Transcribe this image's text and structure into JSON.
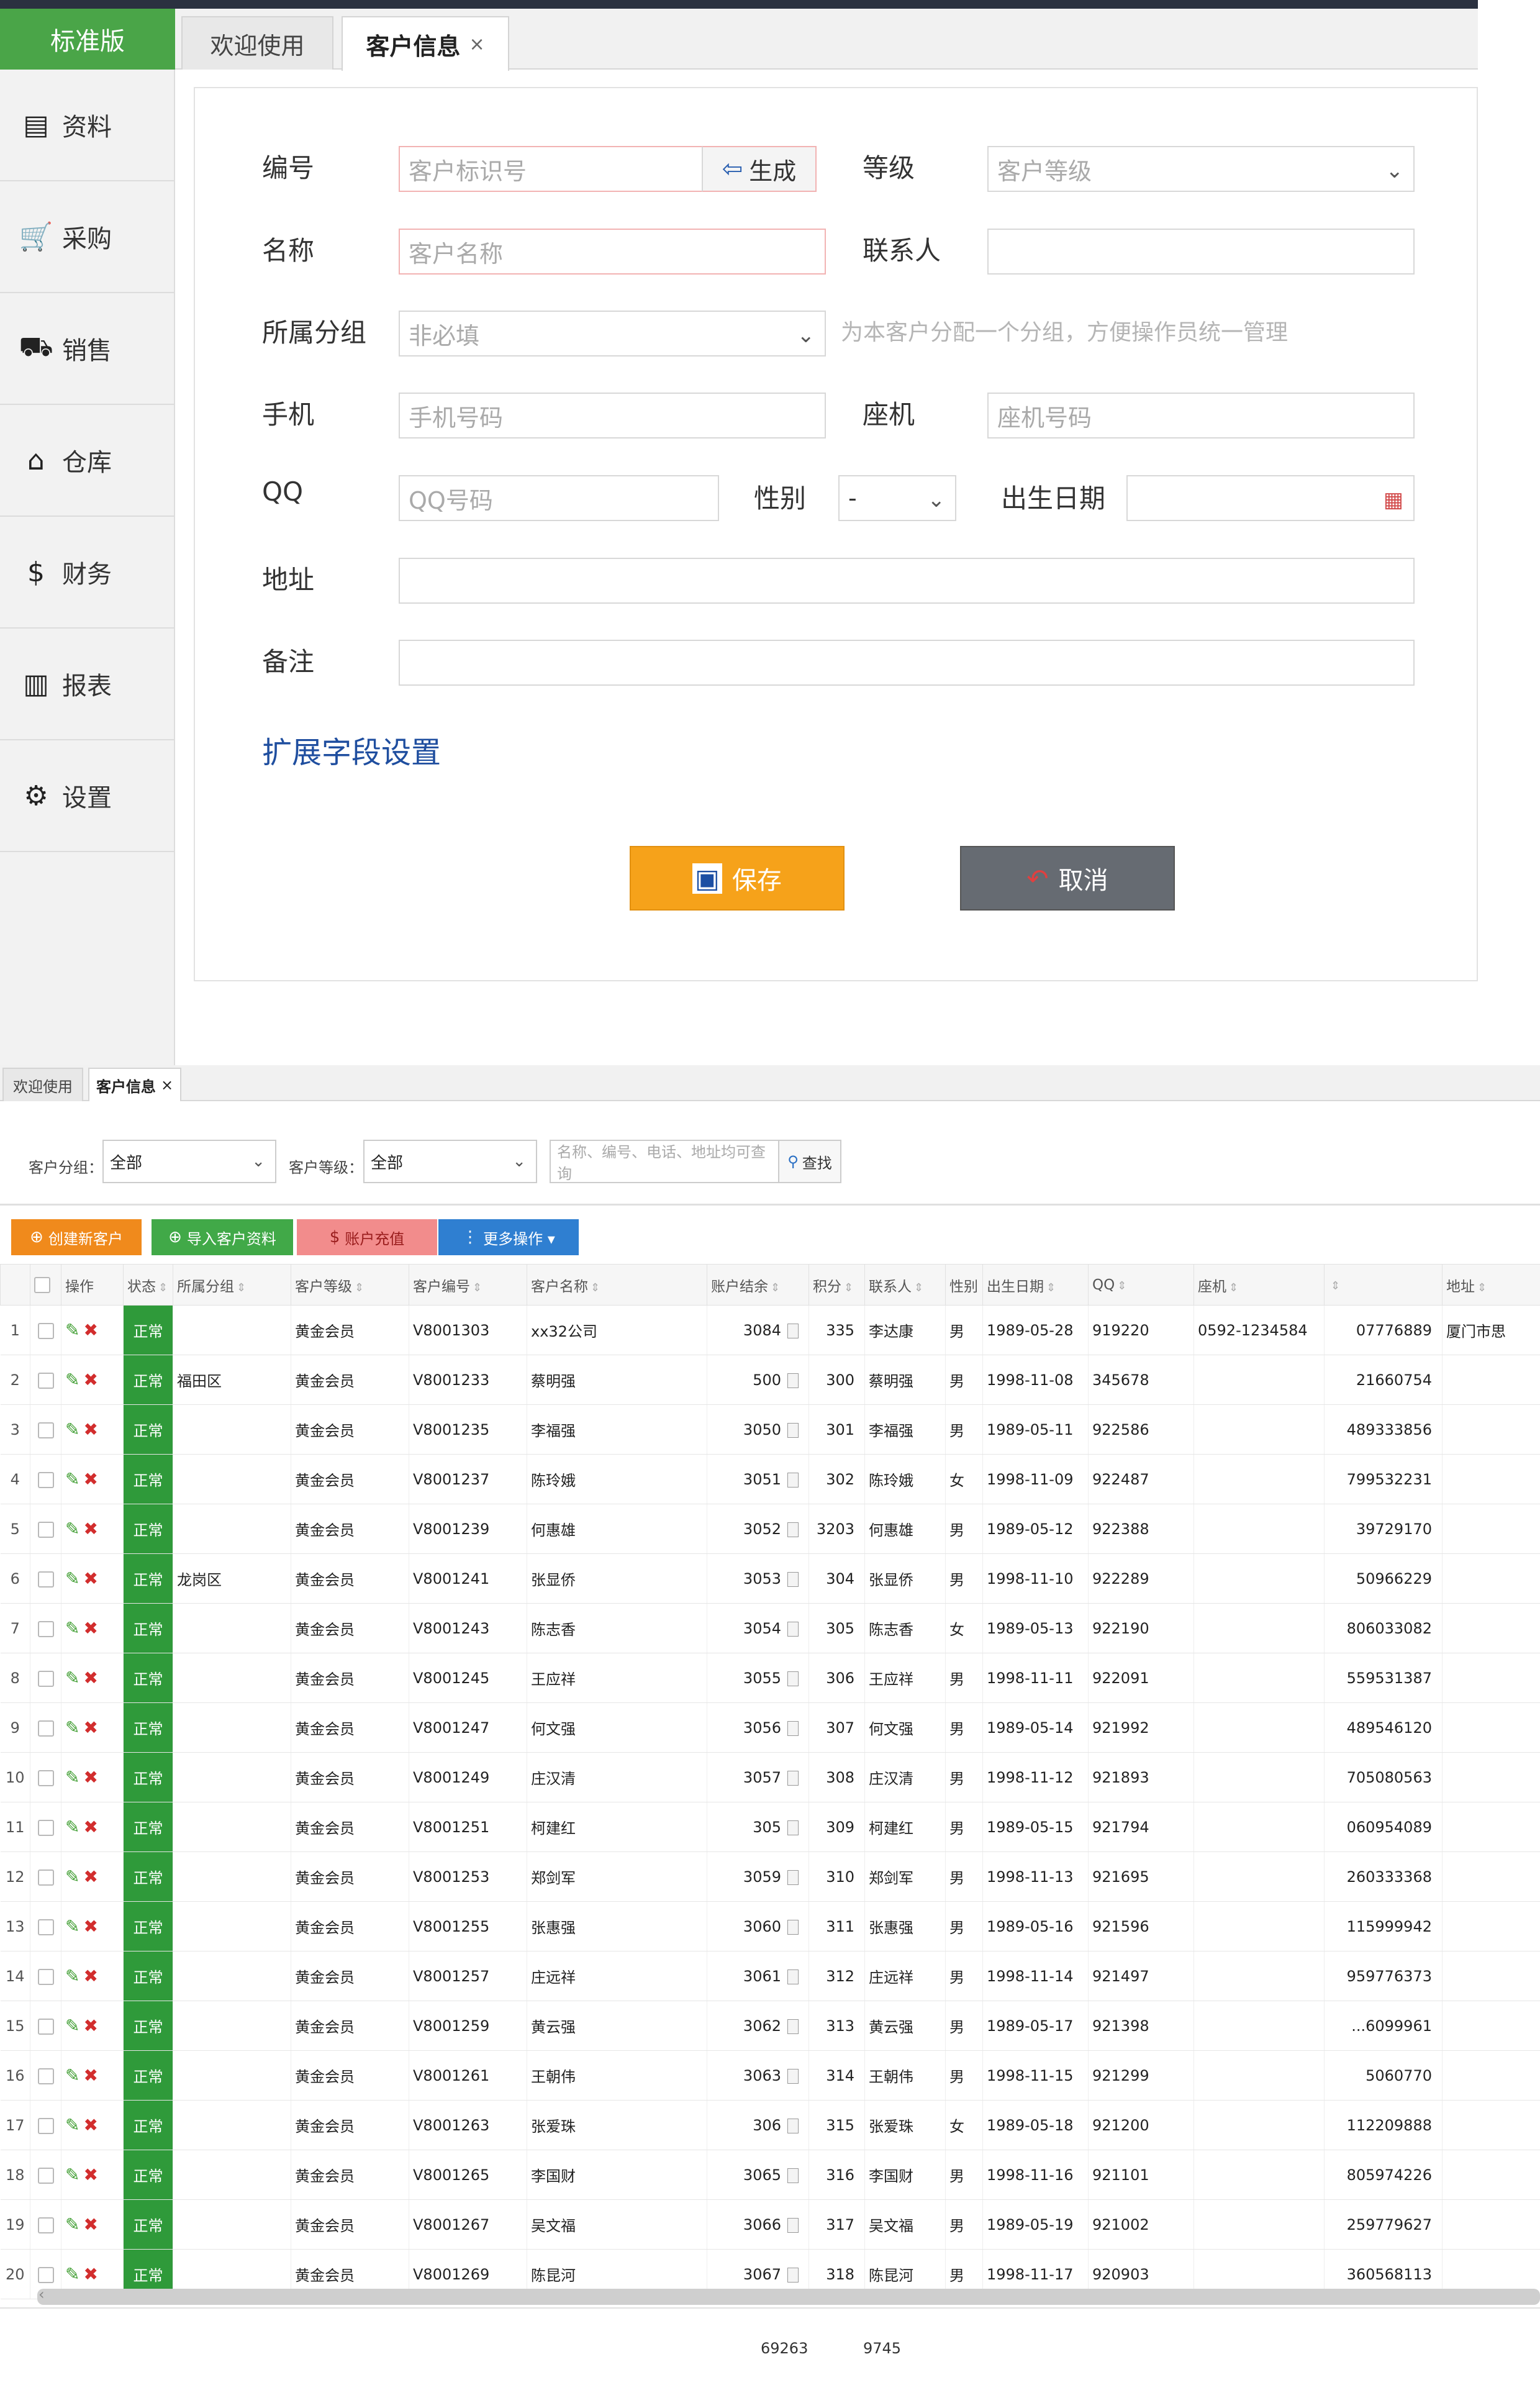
{
  "top": {
    "edition": "标准版",
    "sidebar": [
      {
        "icon": "database-icon",
        "label": "资料"
      },
      {
        "icon": "cart-icon",
        "label": "采购"
      },
      {
        "icon": "truck-icon",
        "label": "销售"
      },
      {
        "icon": "warehouse-icon",
        "label": "仓库"
      },
      {
        "icon": "money-icon",
        "label": "财务"
      },
      {
        "icon": "report-icon",
        "label": "报表"
      },
      {
        "icon": "gear-icon",
        "label": "设置"
      }
    ],
    "tabs": {
      "welcome": "欢迎使用",
      "customer": "客户信息",
      "close": "×"
    },
    "form": {
      "code_label": "编号",
      "code_placeholder": "客户标识号",
      "generate_label": "生成",
      "level_label": "等级",
      "level_placeholder": "客户等级",
      "name_label": "名称",
      "name_placeholder": "客户名称",
      "contact_label": "联系人",
      "contact_value": "",
      "group_label": "所属分组",
      "group_placeholder": "非必填",
      "group_hint": "为本客户分配一个分组，方便操作员统一管理",
      "mobile_label": "手机",
      "mobile_placeholder": "手机号码",
      "phone_label": "座机",
      "phone_placeholder": "座机号码",
      "qq_label": "QQ",
      "qq_placeholder": "QQ号码",
      "gender_label": "性别",
      "gender_value": "-",
      "birthday_label": "出生日期",
      "birthday_value": "",
      "address_label": "地址",
      "address_value": "",
      "remark_label": "备注",
      "remark_value": "",
      "extend_link": "扩展字段设置",
      "save_label": "保存",
      "cancel_label": "取消"
    }
  },
  "bottom": {
    "tabs": {
      "welcome": "欢迎使用",
      "customer": "客户信息",
      "close": "×"
    },
    "filters": {
      "group_label": "客户分组：",
      "group_value": "全部",
      "level_label": "客户等级：",
      "level_value": "全部",
      "search_placeholder": "名称、编号、电话、地址均可查询",
      "search_label": "查找"
    },
    "actions": {
      "create": "创建新客户",
      "import": "导入客户资料",
      "recharge": "账户充值",
      "more": "更多操作 ▾"
    },
    "columns": [
      "",
      "操作",
      "状态",
      "所属分组",
      "客户等级",
      "客户编号",
      "客户名称",
      "账户结余",
      "积分",
      "联系人",
      "性别",
      "出生日期",
      "QQ",
      "座机",
      "",
      "地址"
    ],
    "rows": [
      {
        "n": "1",
        "status": "正常",
        "group": "",
        "level": "黄金会员",
        "code": "V8001303",
        "name": "xx32公司",
        "balance": "3084",
        "points": "335",
        "contact": "李达康",
        "sex": "男",
        "birth": "1989-05-28",
        "qq": "919220",
        "phone": "0592-1234584",
        "mobile": "07776889",
        "addr": "厦门市思"
      },
      {
        "n": "2",
        "status": "正常",
        "group": "福田区",
        "level": "黄金会员",
        "code": "V8001233",
        "name": "蔡明强",
        "balance": "500",
        "points": "300",
        "contact": "蔡明强",
        "sex": "男",
        "birth": "1998-11-08",
        "qq": "345678",
        "phone": "",
        "mobile": "21660754",
        "addr": ""
      },
      {
        "n": "3",
        "status": "正常",
        "group": "",
        "level": "黄金会员",
        "code": "V8001235",
        "name": "李福强",
        "balance": "3050",
        "points": "301",
        "contact": "李福强",
        "sex": "男",
        "birth": "1989-05-11",
        "qq": "922586",
        "phone": "",
        "mobile": "489333856",
        "addr": ""
      },
      {
        "n": "4",
        "status": "正常",
        "group": "",
        "level": "黄金会员",
        "code": "V8001237",
        "name": "陈玲娥",
        "balance": "3051",
        "points": "302",
        "contact": "陈玲娥",
        "sex": "女",
        "birth": "1998-11-09",
        "qq": "922487",
        "phone": "",
        "mobile": "799532231",
        "addr": ""
      },
      {
        "n": "5",
        "status": "正常",
        "group": "",
        "level": "黄金会员",
        "code": "V8001239",
        "name": "何惠雄",
        "balance": "3052",
        "points": "3203",
        "contact": "何惠雄",
        "sex": "男",
        "birth": "1989-05-12",
        "qq": "922388",
        "phone": "",
        "mobile": "39729170",
        "addr": ""
      },
      {
        "n": "6",
        "status": "正常",
        "group": "龙岗区",
        "level": "黄金会员",
        "code": "V8001241",
        "name": "张显侨",
        "balance": "3053",
        "points": "304",
        "contact": "张显侨",
        "sex": "男",
        "birth": "1998-11-10",
        "qq": "922289",
        "phone": "",
        "mobile": "50966229",
        "addr": ""
      },
      {
        "n": "7",
        "status": "正常",
        "group": "",
        "level": "黄金会员",
        "code": "V8001243",
        "name": "陈志香",
        "balance": "3054",
        "points": "305",
        "contact": "陈志香",
        "sex": "女",
        "birth": "1989-05-13",
        "qq": "922190",
        "phone": "",
        "mobile": "806033082",
        "addr": ""
      },
      {
        "n": "8",
        "status": "正常",
        "group": "",
        "level": "黄金会员",
        "code": "V8001245",
        "name": "王应祥",
        "balance": "3055",
        "points": "306",
        "contact": "王应祥",
        "sex": "男",
        "birth": "1998-11-11",
        "qq": "922091",
        "phone": "",
        "mobile": "559531387",
        "addr": ""
      },
      {
        "n": "9",
        "status": "正常",
        "group": "",
        "level": "黄金会员",
        "code": "V8001247",
        "name": "何文强",
        "balance": "3056",
        "points": "307",
        "contact": "何文强",
        "sex": "男",
        "birth": "1989-05-14",
        "qq": "921992",
        "phone": "",
        "mobile": "489546120",
        "addr": ""
      },
      {
        "n": "10",
        "status": "正常",
        "group": "",
        "level": "黄金会员",
        "code": "V8001249",
        "name": "庄汉清",
        "balance": "3057",
        "points": "308",
        "contact": "庄汉清",
        "sex": "男",
        "birth": "1998-11-12",
        "qq": "921893",
        "phone": "",
        "mobile": "705080563",
        "addr": ""
      },
      {
        "n": "11",
        "status": "正常",
        "group": "",
        "level": "黄金会员",
        "code": "V8001251",
        "name": "柯建红",
        "balance": "305",
        "points": "309",
        "contact": "柯建红",
        "sex": "男",
        "birth": "1989-05-15",
        "qq": "921794",
        "phone": "",
        "mobile": "060954089",
        "addr": ""
      },
      {
        "n": "12",
        "status": "正常",
        "group": "",
        "level": "黄金会员",
        "code": "V8001253",
        "name": "郑剑军",
        "balance": "3059",
        "points": "310",
        "contact": "郑剑军",
        "sex": "男",
        "birth": "1998-11-13",
        "qq": "921695",
        "phone": "",
        "mobile": "260333368",
        "addr": ""
      },
      {
        "n": "13",
        "status": "正常",
        "group": "",
        "level": "黄金会员",
        "code": "V8001255",
        "name": "张惠强",
        "balance": "3060",
        "points": "311",
        "contact": "张惠强",
        "sex": "男",
        "birth": "1989-05-16",
        "qq": "921596",
        "phone": "",
        "mobile": "115999942",
        "addr": ""
      },
      {
        "n": "14",
        "status": "正常",
        "group": "",
        "level": "黄金会员",
        "code": "V8001257",
        "name": "庄远祥",
        "balance": "3061",
        "points": "312",
        "contact": "庄远祥",
        "sex": "男",
        "birth": "1998-11-14",
        "qq": "921497",
        "phone": "",
        "mobile": "959776373",
        "addr": ""
      },
      {
        "n": "15",
        "status": "正常",
        "group": "",
        "level": "黄金会员",
        "code": "V8001259",
        "name": "黄云强",
        "balance": "3062",
        "points": "313",
        "contact": "黄云强",
        "sex": "男",
        "birth": "1989-05-17",
        "qq": "921398",
        "phone": "",
        "mobile": "...6099961",
        "addr": ""
      },
      {
        "n": "16",
        "status": "正常",
        "group": "",
        "level": "黄金会员",
        "code": "V8001261",
        "name": "王朝伟",
        "balance": "3063",
        "points": "314",
        "contact": "王朝伟",
        "sex": "男",
        "birth": "1998-11-15",
        "qq": "921299",
        "phone": "",
        "mobile": "5060770",
        "addr": ""
      },
      {
        "n": "17",
        "status": "正常",
        "group": "",
        "level": "黄金会员",
        "code": "V8001263",
        "name": "张爱珠",
        "balance": "306",
        "points": "315",
        "contact": "张爱珠",
        "sex": "女",
        "birth": "1989-05-18",
        "qq": "921200",
        "phone": "",
        "mobile": "112209888",
        "addr": ""
      },
      {
        "n": "18",
        "status": "正常",
        "group": "",
        "level": "黄金会员",
        "code": "V8001265",
        "name": "李国财",
        "balance": "3065",
        "points": "316",
        "contact": "李国财",
        "sex": "男",
        "birth": "1998-11-16",
        "qq": "921101",
        "phone": "",
        "mobile": "805974226",
        "addr": ""
      },
      {
        "n": "19",
        "status": "正常",
        "group": "",
        "level": "黄金会员",
        "code": "V8001267",
        "name": "吴文福",
        "balance": "3066",
        "points": "317",
        "contact": "吴文福",
        "sex": "男",
        "birth": "1989-05-19",
        "qq": "921002",
        "phone": "",
        "mobile": "259779627",
        "addr": ""
      },
      {
        "n": "20",
        "status": "正常",
        "group": "",
        "level": "黄金会员",
        "code": "V8001269",
        "name": "陈昆河",
        "balance": "3067",
        "points": "318",
        "contact": "陈昆河",
        "sex": "男",
        "birth": "1998-11-17",
        "qq": "920903",
        "phone": "",
        "mobile": "360568113",
        "addr": ""
      }
    ],
    "totals": {
      "balance": "69263",
      "points": "9745"
    }
  }
}
